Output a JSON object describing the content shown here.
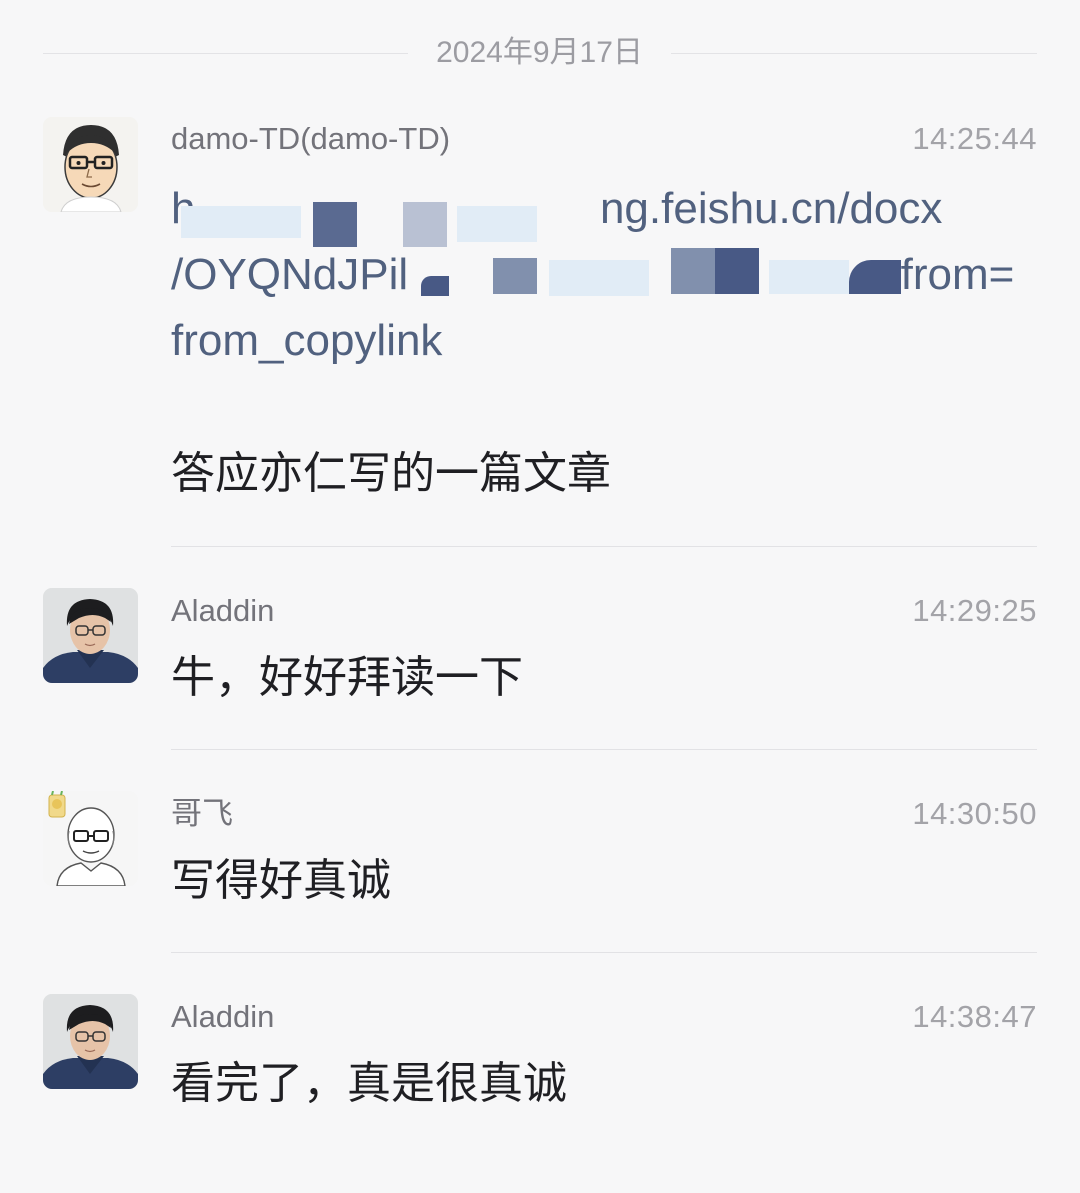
{
  "date_divider": "2024年9月17日",
  "messages": [
    {
      "sender": "damo-TD(damo-TD)",
      "time": "14:25:44",
      "link_lines": [
        "h",
        "ng.feishu.cn/docx",
        "/OYQNdJPil",
        "from=",
        "from_copylink"
      ],
      "text": "答应亦仁写的一篇文章",
      "avatar_icon": "cartoon-man-glasses-avatar"
    },
    {
      "sender": "Aladdin",
      "time": "14:29:25",
      "text": "牛，好好拜读一下",
      "avatar_icon": "young-man-glasses-photo-avatar"
    },
    {
      "sender": "哥飞",
      "time": "14:30:50",
      "text": "写得好真诚",
      "avatar_icon": "bald-man-glasses-sketch-avatar"
    },
    {
      "sender": "Aladdin",
      "time": "14:38:47",
      "text": "看完了，真是很真诚",
      "avatar_icon": "young-man-glasses-photo-avatar"
    }
  ],
  "colors": {
    "background": "#f7f7f8",
    "link": "#51617f",
    "redaction": "#5a6a91",
    "sender": "#73737a",
    "time": "#a3a3a8"
  }
}
